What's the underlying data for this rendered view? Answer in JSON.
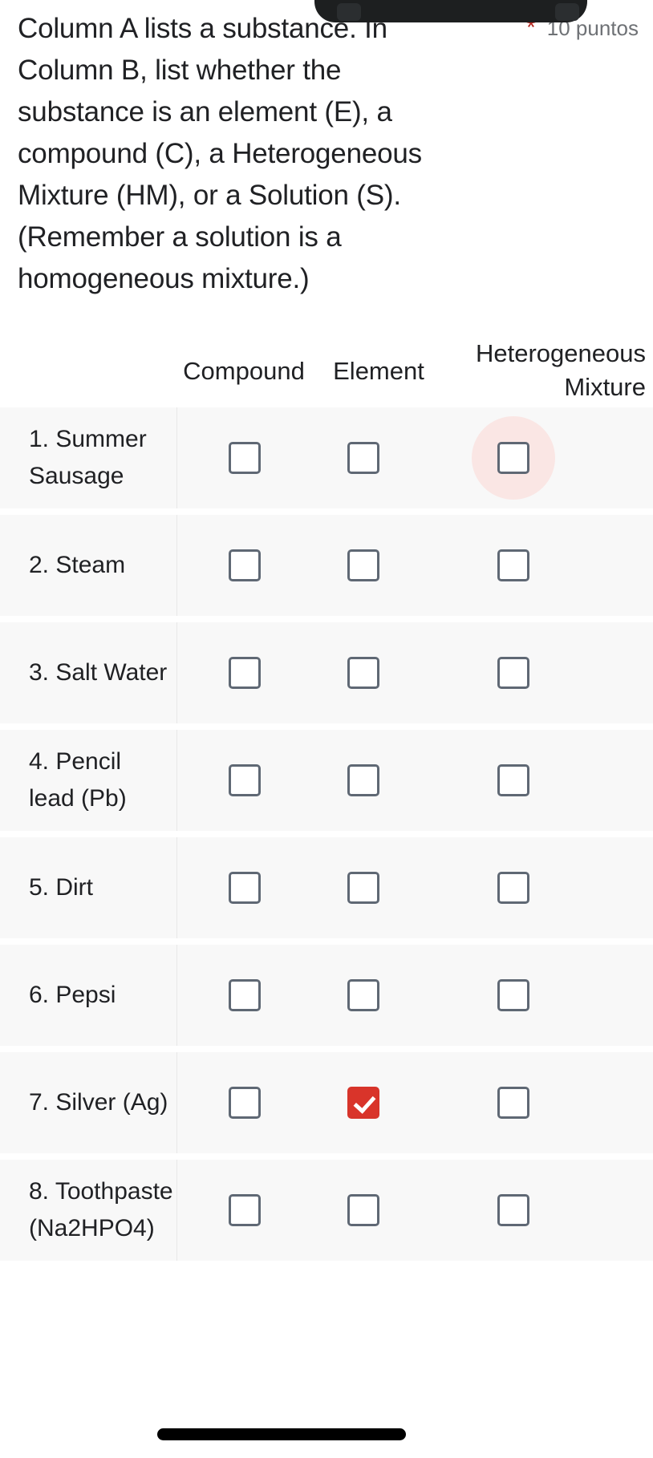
{
  "question": {
    "text": "Column A lists a substance.  In Column B, list whether the substance is an element (E), a compound (C), a Heterogeneous Mixture (HM), or a Solution (S). (Remember a solution is a homogeneous mixture.)",
    "required_marker": "*",
    "points_label": "10 puntos"
  },
  "grid": {
    "columns": [
      {
        "label": "Compound"
      },
      {
        "label": "Element"
      },
      {
        "label": "Heterogeneous\nMixture"
      }
    ],
    "rows": [
      {
        "label": "1. Summer Sausage",
        "checked": [
          false,
          false,
          false
        ],
        "ripple": [
          false,
          false,
          true
        ]
      },
      {
        "label": "2. Steam",
        "checked": [
          false,
          false,
          false
        ],
        "ripple": [
          false,
          false,
          false
        ]
      },
      {
        "label": "3. Salt Water",
        "checked": [
          false,
          false,
          false
        ],
        "ripple": [
          false,
          false,
          false
        ]
      },
      {
        "label": "4. Pencil lead (Pb)",
        "checked": [
          false,
          false,
          false
        ],
        "ripple": [
          false,
          false,
          false
        ]
      },
      {
        "label": "5. Dirt",
        "checked": [
          false,
          false,
          false
        ],
        "ripple": [
          false,
          false,
          false
        ]
      },
      {
        "label": "6. Pepsi",
        "checked": [
          false,
          false,
          false
        ],
        "ripple": [
          false,
          false,
          false
        ]
      },
      {
        "label": "7. Silver (Ag)",
        "checked": [
          false,
          true,
          false
        ],
        "ripple": [
          false,
          false,
          false
        ]
      },
      {
        "label": "8. Toothpaste (Na2HPO4)",
        "checked": [
          false,
          false,
          false
        ],
        "ripple": [
          false,
          false,
          false
        ]
      }
    ]
  },
  "colors": {
    "checked_accent": "#d9342a",
    "required_asterisk": "#b3261e",
    "ripple": "#fae6e4",
    "row_background": "#f8f8f8",
    "checkbox_border": "#5f6874",
    "text": "#202124",
    "muted_text": "#6e7175"
  }
}
